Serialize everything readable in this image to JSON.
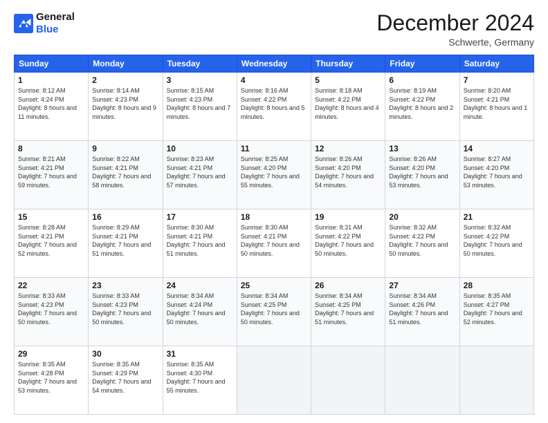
{
  "logo": {
    "line1": "General",
    "line2": "Blue"
  },
  "title": "December 2024",
  "subtitle": "Schwerte, Germany",
  "weekdays": [
    "Sunday",
    "Monday",
    "Tuesday",
    "Wednesday",
    "Thursday",
    "Friday",
    "Saturday"
  ],
  "weeks": [
    [
      {
        "day": "1",
        "sunrise": "8:12 AM",
        "sunset": "4:24 PM",
        "daylight": "8 hours and 11 minutes."
      },
      {
        "day": "2",
        "sunrise": "8:14 AM",
        "sunset": "4:23 PM",
        "daylight": "8 hours and 9 minutes."
      },
      {
        "day": "3",
        "sunrise": "8:15 AM",
        "sunset": "4:23 PM",
        "daylight": "8 hours and 7 minutes."
      },
      {
        "day": "4",
        "sunrise": "8:16 AM",
        "sunset": "4:22 PM",
        "daylight": "8 hours and 5 minutes."
      },
      {
        "day": "5",
        "sunrise": "8:18 AM",
        "sunset": "4:22 PM",
        "daylight": "8 hours and 4 minutes."
      },
      {
        "day": "6",
        "sunrise": "8:19 AM",
        "sunset": "4:22 PM",
        "daylight": "8 hours and 2 minutes."
      },
      {
        "day": "7",
        "sunrise": "8:20 AM",
        "sunset": "4:21 PM",
        "daylight": "8 hours and 1 minute."
      }
    ],
    [
      {
        "day": "8",
        "sunrise": "8:21 AM",
        "sunset": "4:21 PM",
        "daylight": "7 hours and 59 minutes."
      },
      {
        "day": "9",
        "sunrise": "8:22 AM",
        "sunset": "4:21 PM",
        "daylight": "7 hours and 58 minutes."
      },
      {
        "day": "10",
        "sunrise": "8:23 AM",
        "sunset": "4:21 PM",
        "daylight": "7 hours and 57 minutes."
      },
      {
        "day": "11",
        "sunrise": "8:25 AM",
        "sunset": "4:20 PM",
        "daylight": "7 hours and 55 minutes."
      },
      {
        "day": "12",
        "sunrise": "8:26 AM",
        "sunset": "4:20 PM",
        "daylight": "7 hours and 54 minutes."
      },
      {
        "day": "13",
        "sunrise": "8:26 AM",
        "sunset": "4:20 PM",
        "daylight": "7 hours and 53 minutes."
      },
      {
        "day": "14",
        "sunrise": "8:27 AM",
        "sunset": "4:20 PM",
        "daylight": "7 hours and 53 minutes."
      }
    ],
    [
      {
        "day": "15",
        "sunrise": "8:28 AM",
        "sunset": "4:21 PM",
        "daylight": "7 hours and 52 minutes."
      },
      {
        "day": "16",
        "sunrise": "8:29 AM",
        "sunset": "4:21 PM",
        "daylight": "7 hours and 51 minutes."
      },
      {
        "day": "17",
        "sunrise": "8:30 AM",
        "sunset": "4:21 PM",
        "daylight": "7 hours and 51 minutes."
      },
      {
        "day": "18",
        "sunrise": "8:30 AM",
        "sunset": "4:21 PM",
        "daylight": "7 hours and 50 minutes."
      },
      {
        "day": "19",
        "sunrise": "8:31 AM",
        "sunset": "4:22 PM",
        "daylight": "7 hours and 50 minutes."
      },
      {
        "day": "20",
        "sunrise": "8:32 AM",
        "sunset": "4:22 PM",
        "daylight": "7 hours and 50 minutes."
      },
      {
        "day": "21",
        "sunrise": "8:32 AM",
        "sunset": "4:22 PM",
        "daylight": "7 hours and 50 minutes."
      }
    ],
    [
      {
        "day": "22",
        "sunrise": "8:33 AM",
        "sunset": "4:23 PM",
        "daylight": "7 hours and 50 minutes."
      },
      {
        "day": "23",
        "sunrise": "8:33 AM",
        "sunset": "4:23 PM",
        "daylight": "7 hours and 50 minutes."
      },
      {
        "day": "24",
        "sunrise": "8:34 AM",
        "sunset": "4:24 PM",
        "daylight": "7 hours and 50 minutes."
      },
      {
        "day": "25",
        "sunrise": "8:34 AM",
        "sunset": "4:25 PM",
        "daylight": "7 hours and 50 minutes."
      },
      {
        "day": "26",
        "sunrise": "8:34 AM",
        "sunset": "4:25 PM",
        "daylight": "7 hours and 51 minutes."
      },
      {
        "day": "27",
        "sunrise": "8:34 AM",
        "sunset": "4:26 PM",
        "daylight": "7 hours and 51 minutes."
      },
      {
        "day": "28",
        "sunrise": "8:35 AM",
        "sunset": "4:27 PM",
        "daylight": "7 hours and 52 minutes."
      }
    ],
    [
      {
        "day": "29",
        "sunrise": "8:35 AM",
        "sunset": "4:28 PM",
        "daylight": "7 hours and 53 minutes."
      },
      {
        "day": "30",
        "sunrise": "8:35 AM",
        "sunset": "4:29 PM",
        "daylight": "7 hours and 54 minutes."
      },
      {
        "day": "31",
        "sunrise": "8:35 AM",
        "sunset": "4:30 PM",
        "daylight": "7 hours and 55 minutes."
      },
      null,
      null,
      null,
      null
    ]
  ]
}
